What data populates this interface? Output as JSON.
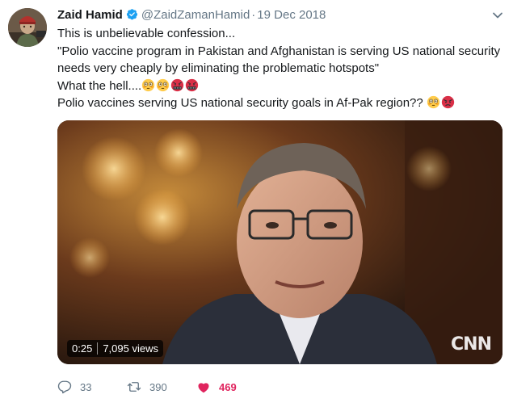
{
  "author": {
    "name": "Zaid Hamid",
    "handle": "@ZaidZamanHamid",
    "separator": "·",
    "date": "19 Dec 2018"
  },
  "tweet": {
    "line1": "This is unbelievable confession...",
    "line2": "\"Polio vaccine program in Pakistan and Afghanistan is serving US national security",
    "line3": "needs very cheaply by eliminating the problematic hotspots\"",
    "line4": "What the hell....",
    "line5": "Polio vaccines serving US national security goals in Af-Pak region??"
  },
  "media": {
    "duration": "0:25",
    "views": "7,095 views",
    "watermark": "CNN"
  },
  "actions": {
    "replies": "33",
    "retweets": "390",
    "likes": "469"
  },
  "colors": {
    "like": "#e0245e",
    "verified": "#1da1f2",
    "muted": "#657786"
  },
  "icons": [
    "verified-badge-icon",
    "caret-down-icon",
    "flushed-face-emoji",
    "cursing-face-emoji",
    "angry-face-emoji",
    "reply-icon",
    "retweet-icon",
    "heart-icon"
  ]
}
